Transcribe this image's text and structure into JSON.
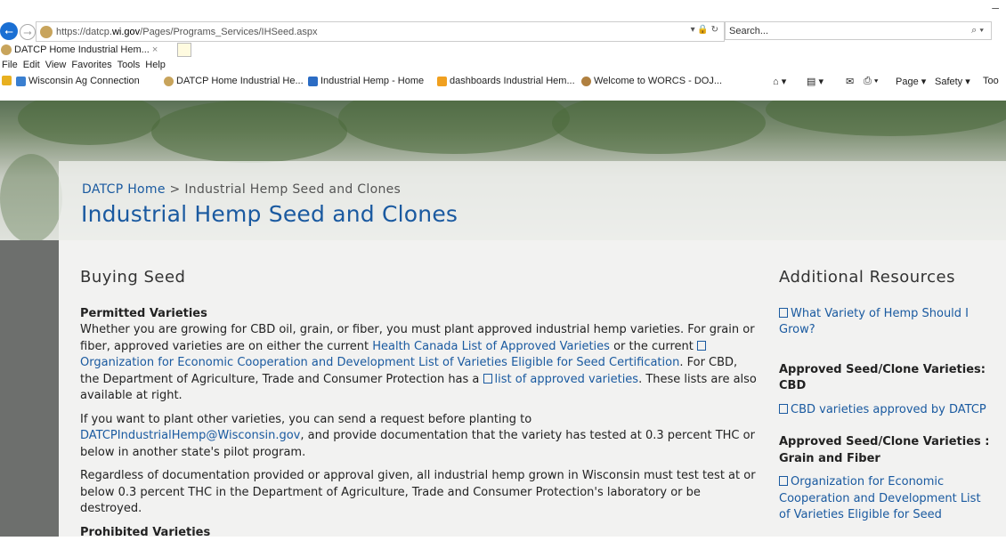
{
  "browser": {
    "minimize_glyph": "–",
    "back_glyph": "⭠",
    "forward_glyph": "⭢",
    "url_prefix": "https://datcp.",
    "url_domain": "wi.gov",
    "url_path": "/Pages/Programs_Services/IHSeed.aspx",
    "address_controls": "▾ 🔒 ↻",
    "search_placeholder": "Search...",
    "search_icon": "⌕ ▾",
    "tab_title": "DATCP Home Industrial Hem...",
    "tab_close": "×",
    "menu": [
      "File",
      "Edit",
      "View",
      "Favorites",
      "Tools",
      "Help"
    ],
    "favorites": [
      "Wisconsin Ag Connection",
      "DATCP Home Industrial He...",
      "Industrial Hemp - Home",
      "dashboards Industrial Hem...",
      "Welcome to WORCS - DOJ..."
    ],
    "commands": {
      "home": "⌂ ▾",
      "feeds": "▤ ▾",
      "mail": "✉",
      "print": "⎙ ▾",
      "page": "Page ▾",
      "safety": "Safety ▾",
      "tools": "Too"
    }
  },
  "breadcrumb": {
    "home": "DATCP Home",
    "separator": ">",
    "current": "Industrial Hemp Seed and Clones"
  },
  "page_title": "Industrial Hemp Seed and Clones",
  "main": {
    "heading": "Buying Seed",
    "permitted_heading": "Permitted Varieties",
    "p1_a": "Whether you are growing for CBD oil, grain, or fiber, you must plant approved industrial hemp varieties. For grain or fiber, approved varieties are on either the current ",
    "p1_link1": "Health Canada List of Approved Varieties",
    "p1_b": " or the current ",
    "p1_link2": "Organization for Economic Cooperation and Development List of Varieties Eligible for Seed Certification",
    "p1_c": ".  For CBD, the Department of Agriculture, Trade and Consumer Protection has a ",
    "p1_link3": "list of approved varieties",
    "p1_d": ". These lists are also available at right.",
    "p2_a": "If you want to plant other varieties, you can send a request before planting to ",
    "p2_link": "DATCPIndustrialHemp@Wisconsin.gov",
    "p2_b": ", and provide documentation that the variety has tested at 0.3 percent THC or below in another state's pilot program.",
    "p3": "Regardless of documentation provided or approval given, all industrial hemp grown in Wisconsin must test test at or below 0.3 percent THC in the Department of Agriculture, Trade and Consumer Protection's laboratory or be destroyed.",
    "prohibited_heading": "Prohibited Varieties"
  },
  "sidebar": {
    "heading": "Additional Resources",
    "link1": "What Variety of Hemp Should I Grow?",
    "cbd_heading": "Approved Seed/Clone Varieties: CBD",
    "cbd_link": "CBD varieties approved by DATCP",
    "grain_heading": "Approved Seed/Clone Varieties : Grain and Fiber",
    "grain_link": "Organization for Economic Cooperation and Development List of Varieties Eligible for Seed"
  }
}
